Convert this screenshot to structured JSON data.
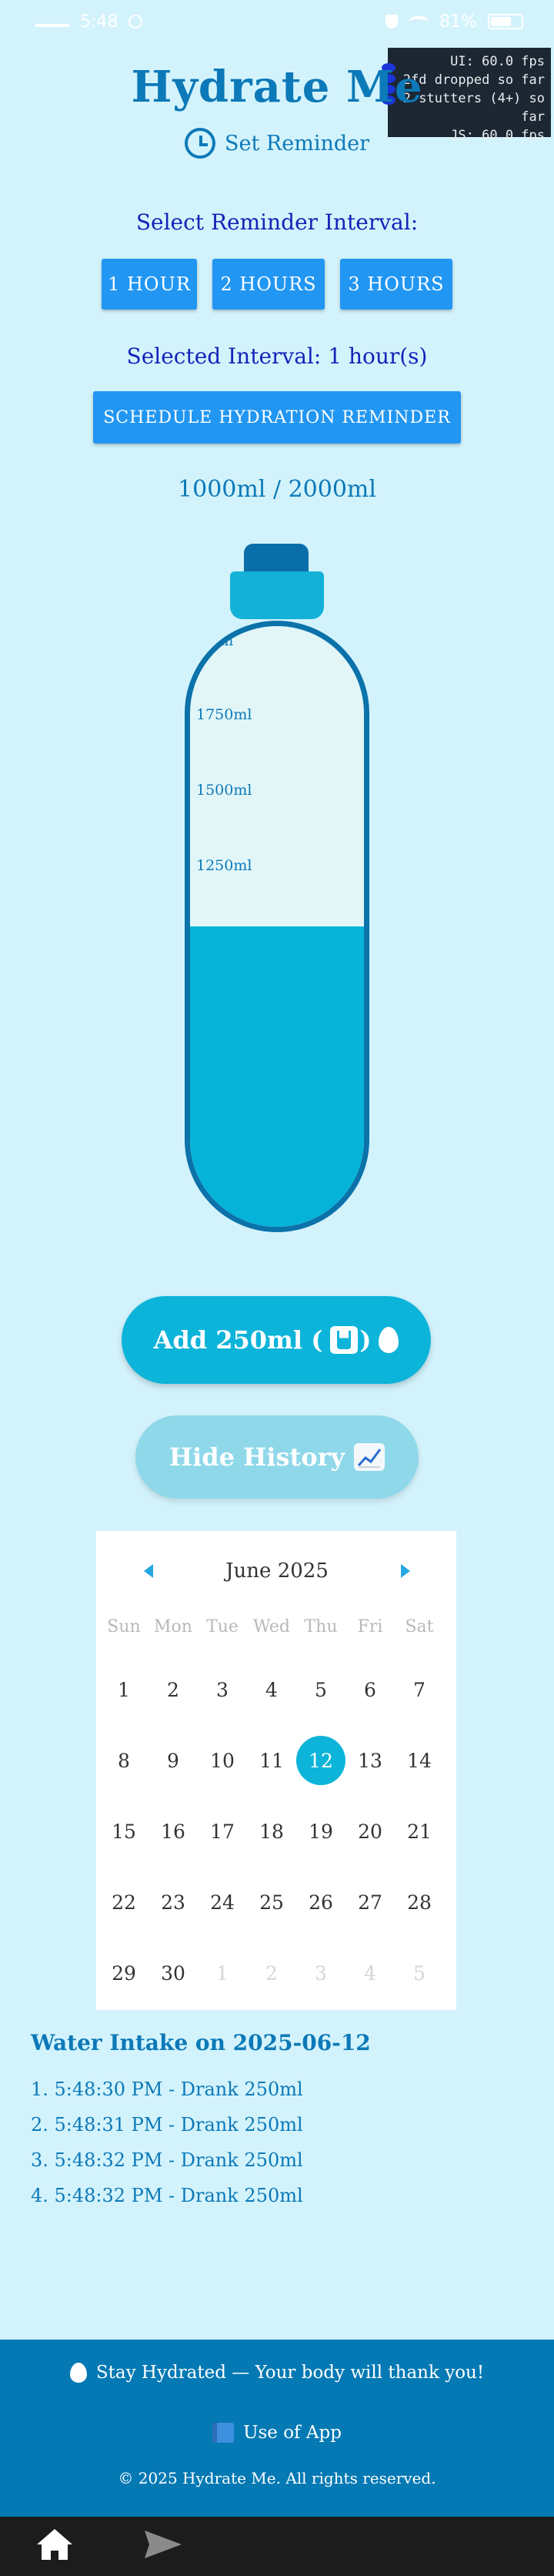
{
  "status_bar": {
    "time": "5:48",
    "battery_percent": "81%"
  },
  "fps_overlay": {
    "ui": "UI: 60.0 fps",
    "dropped": "2fd dropped so far",
    "stutters": "2 stutters (4+) so far",
    "js": "JS: 60.0 fps"
  },
  "header": {
    "title": "Hydrate Me",
    "set_reminder": "Set Reminder",
    "icon": "clock-icon"
  },
  "reminder": {
    "select_label": "Select Reminder Interval:",
    "options": [
      "1 HOUR",
      "2 HOURS",
      "3 HOURS"
    ],
    "selected_label": "Selected Interval: 1 hour(s)",
    "schedule_button": "SCHEDULE HYDRATION REMINDER"
  },
  "intake": {
    "summary": "1000ml / 2000ml",
    "fill_fraction": 0.5,
    "bottle_marks": [
      "2000ml",
      "1750ml",
      "1500ml",
      "1250ml"
    ]
  },
  "actions": {
    "add_label": "Add 250ml (",
    "add_suffix": ")",
    "hide_history": "Hide History"
  },
  "calendar": {
    "month": "June 2025",
    "weekdays": [
      "Sun",
      "Mon",
      "Tue",
      "Wed",
      "Thu",
      "Fri",
      "Sat"
    ],
    "weeks": [
      [
        "1",
        "2",
        "3",
        "4",
        "5",
        "6",
        "7"
      ],
      [
        "8",
        "9",
        "10",
        "11",
        "12",
        "13",
        "14"
      ],
      [
        "15",
        "16",
        "17",
        "18",
        "19",
        "20",
        "21"
      ],
      [
        "22",
        "23",
        "24",
        "25",
        "26",
        "27",
        "28"
      ],
      [
        "29",
        "30",
        "1",
        "2",
        "3",
        "4",
        "5"
      ]
    ],
    "selected_day": "12",
    "accent_color": "#0db4d9"
  },
  "history": {
    "title": "Water Intake on 2025-06-12",
    "items": [
      "1. 5:48:30 PM - Drank 250ml",
      "2. 5:48:31 PM - Drank 250ml",
      "3. 5:48:32 PM - Drank 250ml",
      "4. 5:48:32 PM - Drank 250ml"
    ]
  },
  "footer": {
    "tagline": "Stay Hydrated — Your body will thank you!",
    "use_of_app": "Use of App",
    "copyright": "© 2025 Hydrate Me. All rights reserved."
  },
  "colors": {
    "background": "#d3f3fc",
    "primary": "#0c79b8",
    "button_blue": "#2196f3",
    "water": "#06b3d8",
    "footer": "#0479b4"
  }
}
